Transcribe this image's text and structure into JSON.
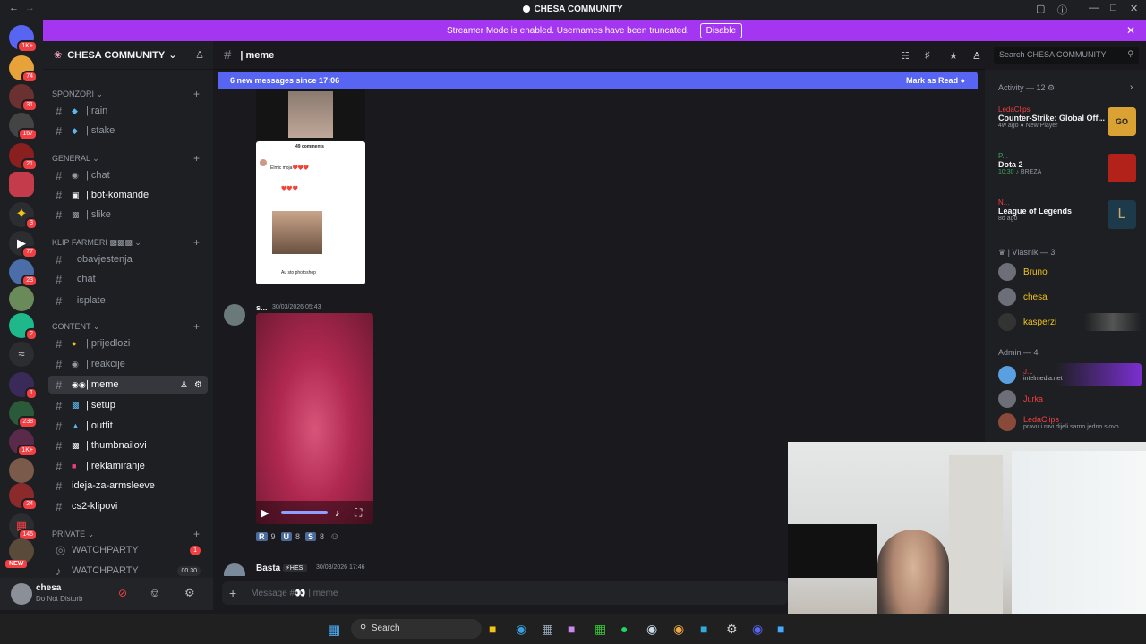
{
  "titlebar": {
    "title": "CHESA COMMUNITY"
  },
  "banner": {
    "text": "Streamer Mode is enabled. Usernames have been truncated.",
    "button": "Disable"
  },
  "server": {
    "name": "CHESA COMMUNITY"
  },
  "rail_badges": [
    "1K+",
    "74",
    "31",
    "167",
    "21",
    "3",
    "77",
    "23",
    "2",
    "1",
    "238",
    "1K+",
    "24",
    "145",
    "NEW"
  ],
  "categories": {
    "sponzori": "SPONZORI",
    "general": "GENERAL",
    "klip": "KLIP FARMERI",
    "content": "CONTENT",
    "private": "PRIVATE"
  },
  "channels": {
    "rain": "| rain",
    "stake": "| stake",
    "chat": "| chat",
    "bot": "| bot-komande",
    "slike": "| slike",
    "obav": "| obavjestenja",
    "chat2": "| chat",
    "isplate": "| isplate",
    "prijedlozi": "| prijedlozi",
    "reakcije": "| reakcije",
    "meme": "| meme",
    "setup": "| setup",
    "outfit": "| outfit",
    "thumb": "| thumbnailovi",
    "reklam": "| reklamiranje",
    "ideja": "ideja-za-armsleeve",
    "cs2": "cs2-klipovi",
    "watch1": "WATCHPARTY",
    "watch1_count": "1",
    "watch2": "WATCHPARTY",
    "watch2_count": "00 30"
  },
  "user": {
    "name": "chesa",
    "status": "Do Not Disturb"
  },
  "chat": {
    "channel": "| meme",
    "search_placeholder": "Search CHESA COMMUNITY",
    "new_messages": "6 new messages since 17:06",
    "mark_read": "Mark as Read",
    "comments_header": "49 comments",
    "comment1": "Elmic moja❤️❤️❤️",
    "comment2": "❤️❤️❤️",
    "comment3": "Au sto photoshop",
    "msg1_author": "s...",
    "msg1_time": "30/03/2026 05:43",
    "reactions": [
      {
        "label": "R",
        "count": "9"
      },
      {
        "label": "U",
        "count": "8"
      },
      {
        "label": "S",
        "count": "8"
      }
    ],
    "msg2_author": "Basta",
    "msg2_tag": "HESI",
    "msg2_time": "30/03/2026 17:46",
    "composer_placeholder": "Message #👀 | meme"
  },
  "members": {
    "activity_header": "Activity — 12",
    "activities": [
      {
        "user": "LedaClips",
        "game": "Counter-Strike: Global Off...",
        "sub": "4w ago",
        "extra": "New Player"
      },
      {
        "user": "P...",
        "game": "Dota 2",
        "sub": "10:30",
        "extra": "BREZA"
      },
      {
        "user": "N...",
        "game": "League of Legends",
        "sub": "8d ago",
        "extra": ""
      }
    ],
    "vlasnik_header": "| Vlasnik — 3",
    "vlasnik": [
      "Bruno",
      "chesa",
      "kasperzi"
    ],
    "admin_header": "Admin — 4",
    "admins": [
      {
        "name": "J...",
        "sub": "intelmedia.net"
      },
      {
        "name": "Jurka",
        "sub": ""
      },
      {
        "name": "LedaClips",
        "sub": "pravu i ruvi dijeli samo jedno slovo"
      }
    ]
  },
  "taskbar": {
    "search": "Search"
  },
  "colors": {
    "accent": "#5865f2",
    "streamer": "#a435f0",
    "danger": "#f23f43"
  }
}
